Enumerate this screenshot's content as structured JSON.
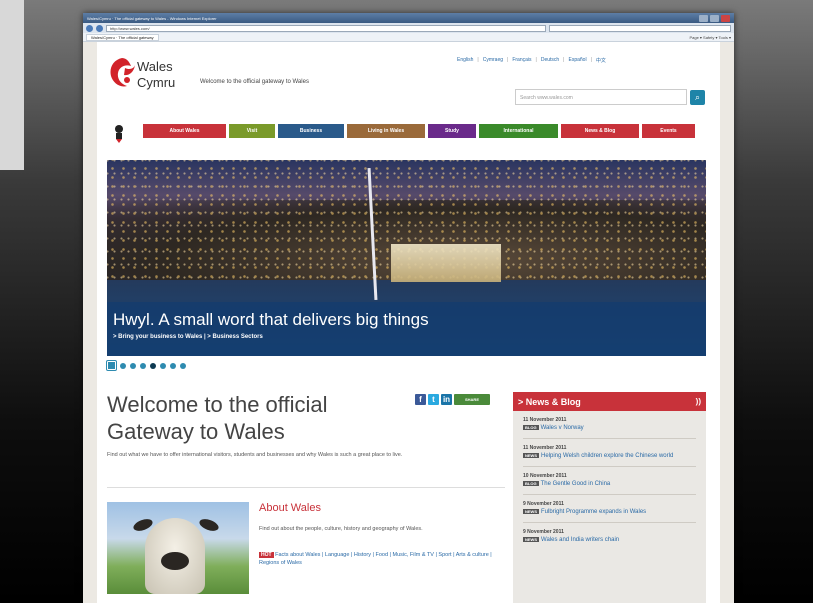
{
  "browser": {
    "title": "Wales/Cymru · The official gateway to Wales - Windows Internet Explorer",
    "url": "http://www.wales.com/",
    "tab": "Wales/Cymru · The official gateway",
    "tools": "Page ▾  Safety ▾  Tools ▾"
  },
  "header": {
    "brand_line1": "Wales",
    "brand_line2": "Cymru",
    "tagline": "Welcome to the official gateway to Wales",
    "languages": [
      "English",
      "Cymraeg",
      "Français",
      "Deutsch",
      "Español",
      "中文"
    ],
    "search_placeholder": "Search www.wales.com",
    "search_icon": "magnifier-icon"
  },
  "nav": [
    {
      "label": "About Wales",
      "color": "#c8323a"
    },
    {
      "label": "Visit",
      "color": "#7a9a2a"
    },
    {
      "label": "Business",
      "color": "#2a5a8a"
    },
    {
      "label": "Living in Wales",
      "color": "#9a6a3a"
    },
    {
      "label": "Study",
      "color": "#6a2a8a"
    },
    {
      "label": "International",
      "color": "#3a8a2a"
    },
    {
      "label": "News & Blog",
      "color": "#c8323a"
    },
    {
      "label": "Events",
      "color": "#c8323a"
    }
  ],
  "hero": {
    "caption": "Hwyl. A small word that delivers big things",
    "links": "> Bring your business to Wales  | > Business Sectors",
    "slides": 8,
    "active_slide": 1
  },
  "welcome": {
    "title_line1": "Welcome to the official",
    "title_line2": "Gateway to Wales",
    "intro": "Find out what we have to offer international visitors, students and businesses and why Wales is such a great place to live.",
    "share_label": "SHARE"
  },
  "about": {
    "title": "About Wales",
    "desc": "Find out about the people, culture, history and geography of Wales.",
    "hot_label": "HOT",
    "links": "Facts about Wales  |  Language  |  History  |  Food  |  Music, Film & TV  |  Sport  |  Arts & culture  |  Regions of Wales"
  },
  "news": {
    "heading": "> News & Blog",
    "items": [
      {
        "date": "11 November 2011",
        "tag": "BLOG",
        "text": "Wales v Norway"
      },
      {
        "date": "11 November 2011",
        "tag": "NEWS",
        "text": "Helping Welsh children explore the Chinese world"
      },
      {
        "date": "10 November 2011",
        "tag": "BLOG",
        "text": "The Gentle Good in China"
      },
      {
        "date": "9 November 2011",
        "tag": "NEWS",
        "text": "Fulbright Programme expands in Wales"
      },
      {
        "date": "9 November 2011",
        "tag": "NEWS",
        "text": "Wales and India writers chain"
      }
    ]
  }
}
